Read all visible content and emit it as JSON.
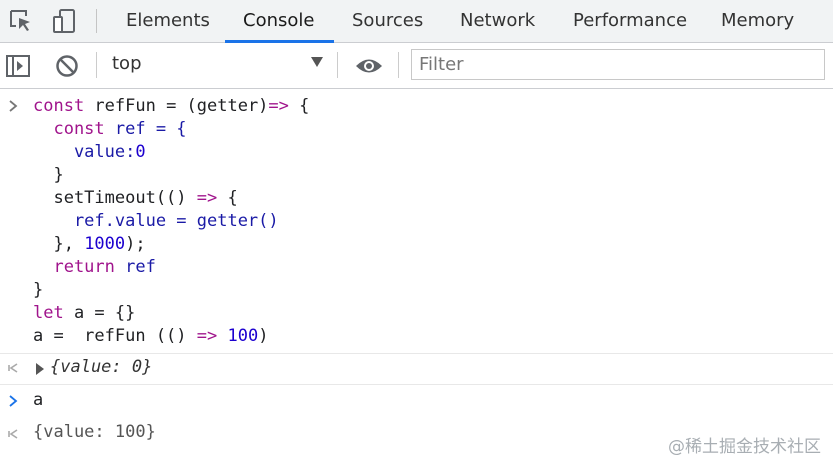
{
  "tabs": [
    {
      "label": "Elements",
      "active": false
    },
    {
      "label": "Console",
      "active": true
    },
    {
      "label": "Sources",
      "active": false
    },
    {
      "label": "Network",
      "active": false
    },
    {
      "label": "Performance",
      "active": false
    },
    {
      "label": "Memory",
      "active": false
    }
  ],
  "toolbar": {
    "context": "top",
    "filter_placeholder": "Filter"
  },
  "console": {
    "input1": {
      "lines": [
        [
          "const",
          " refFun = (getter)",
          "=>",
          " {"
        ],
        [
          "  const",
          " ref = {"
        ],
        [
          "    value:",
          "0"
        ],
        [
          "  }"
        ],
        [
          "  setTimeout(() ",
          "=>",
          " {"
        ],
        [
          "    ref.value = getter()"
        ],
        [
          "  }, ",
          "1000",
          ");"
        ],
        [
          "  return",
          " ref"
        ],
        [
          "}"
        ],
        [
          "let",
          " a = {}"
        ],
        [
          "a =  refFun (() ",
          "=>",
          " ",
          "100",
          ")"
        ]
      ]
    },
    "output1": "{value: 0}",
    "input2": "a",
    "output2": "{value: 100}"
  },
  "watermark": "@稀土掘金技术社区",
  "colors": {
    "accent": "#1a73e8",
    "keyword": "#a0148c",
    "number": "#1c00cf",
    "identifier": "#1a1aa6"
  },
  "icons": [
    "inspect-icon",
    "device-toolbar-icon",
    "sidebar-toggle-icon",
    "clear-console-icon",
    "eye-icon",
    "chevron-right-icon",
    "result-arrow-icon",
    "expand-triangle-icon"
  ]
}
